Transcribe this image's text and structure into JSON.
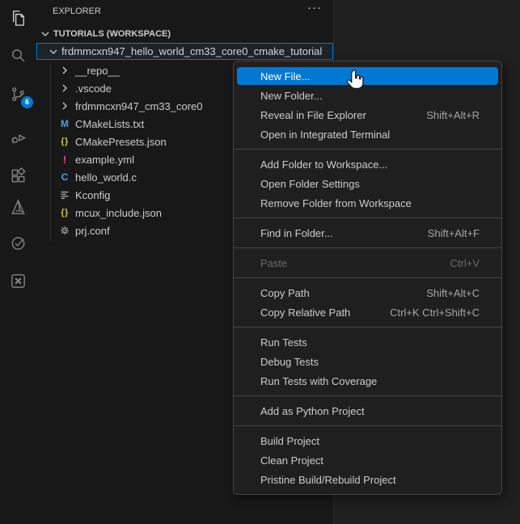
{
  "activity_bar": {
    "items": [
      {
        "icon": "files-icon",
        "active": true
      },
      {
        "icon": "search-icon"
      },
      {
        "icon": "source-control-icon",
        "badge": "6"
      },
      {
        "icon": "run-debug-icon"
      },
      {
        "icon": "extensions-icon"
      },
      {
        "icon": "cmake-icon"
      },
      {
        "icon": "test-check-icon"
      },
      {
        "icon": "x-extension-icon"
      }
    ]
  },
  "explorer": {
    "title": "EXPLORER",
    "more_actions": "···",
    "workspace_label": "TUTORIALS (WORKSPACE)",
    "selected_folder": "frdmmcxn947_hello_world_cm33_core0_cmake_tutorial",
    "tree": [
      {
        "label": "__repo__",
        "type": "folder",
        "icon": "chevron-right-icon"
      },
      {
        "label": ".vscode",
        "type": "folder",
        "icon": "chevron-right-icon"
      },
      {
        "label": "frdmmcxn947_cm33_core0",
        "type": "folder",
        "icon": "chevron-right-icon"
      },
      {
        "label": "CMakeLists.txt",
        "type": "file",
        "icon": "cmake-file-icon",
        "glyph": "M"
      },
      {
        "label": "CMakePresets.json",
        "type": "file",
        "icon": "json-file-icon",
        "glyph": "{}"
      },
      {
        "label": "example.yml",
        "type": "file",
        "icon": "yaml-file-icon",
        "glyph": "!"
      },
      {
        "label": "hello_world.c",
        "type": "file",
        "icon": "c-file-icon",
        "glyph": "C"
      },
      {
        "label": "Kconfig",
        "type": "file",
        "icon": "list-file-icon"
      },
      {
        "label": "mcux_include.json",
        "type": "file",
        "icon": "json-file-icon",
        "glyph": "{}"
      },
      {
        "label": "prj.conf",
        "type": "file",
        "icon": "gear-file-icon"
      }
    ]
  },
  "context_menu": {
    "sections": [
      {
        "items": [
          {
            "label": "New File...",
            "highlighted": true
          },
          {
            "label": "New Folder..."
          },
          {
            "label": "Reveal in File Explorer",
            "shortcut": "Shift+Alt+R"
          },
          {
            "label": "Open in Integrated Terminal"
          }
        ]
      },
      {
        "items": [
          {
            "label": "Add Folder to Workspace..."
          },
          {
            "label": "Open Folder Settings"
          },
          {
            "label": "Remove Folder from Workspace"
          }
        ]
      },
      {
        "items": [
          {
            "label": "Find in Folder...",
            "shortcut": "Shift+Alt+F"
          }
        ]
      },
      {
        "items": [
          {
            "label": "Paste",
            "shortcut": "Ctrl+V",
            "disabled": true
          }
        ]
      },
      {
        "items": [
          {
            "label": "Copy Path",
            "shortcut": "Shift+Alt+C"
          },
          {
            "label": "Copy Relative Path",
            "shortcut": "Ctrl+K Ctrl+Shift+C"
          }
        ]
      },
      {
        "items": [
          {
            "label": "Run Tests"
          },
          {
            "label": "Debug Tests"
          },
          {
            "label": "Run Tests with Coverage"
          }
        ]
      },
      {
        "items": [
          {
            "label": "Add as Python Project"
          }
        ]
      },
      {
        "items": [
          {
            "label": "Build Project"
          },
          {
            "label": "Clean Project"
          },
          {
            "label": "Pristine Build/Rebuild Project"
          }
        ]
      }
    ]
  },
  "colors": {
    "accent_blue": "#0078d4",
    "sidebar_bg": "#181818",
    "editor_bg": "#1f1f1f",
    "menu_bg": "#1f1f1f",
    "menu_border": "#454545",
    "badge_bg": "#0078d4",
    "cmake_icon": "#519fd6",
    "json_icon": "#cbcb41",
    "yaml_icon": "#e2498a",
    "c_icon": "#519fd6",
    "selection_border": "#0078d4"
  }
}
